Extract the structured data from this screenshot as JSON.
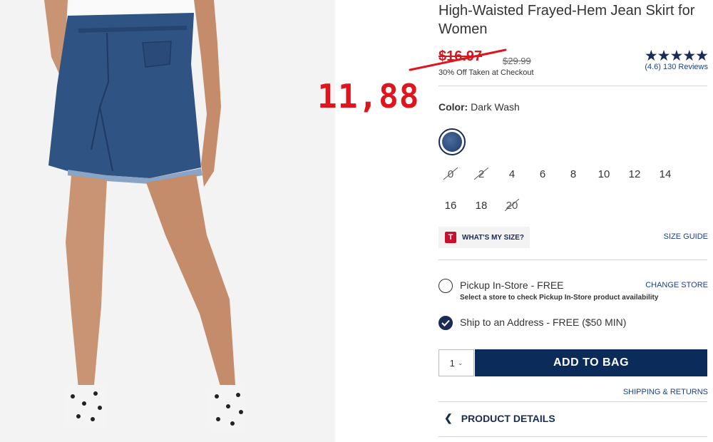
{
  "product": {
    "title": "High-Waisted Frayed-Hem Jean Skirt for Women",
    "sale_price": "$16.97",
    "original_price": "$29.99",
    "promo_note": "30% Off Taken at Checkout",
    "rating_stars": "★★★★★",
    "reviews": "(4.6) 130 Reviews",
    "image_alt": "denim skirt product photo"
  },
  "annotation": {
    "handwritten_price": "11,88",
    "color": "#e0141c"
  },
  "color": {
    "label": "Color:",
    "value": "Dark Wash",
    "swatch_color": "#2b4a78"
  },
  "sizes": [
    {
      "label": "0",
      "available": false
    },
    {
      "label": "2",
      "available": false
    },
    {
      "label": "4",
      "available": true
    },
    {
      "label": "6",
      "available": true
    },
    {
      "label": "8",
      "available": true
    },
    {
      "label": "10",
      "available": true
    },
    {
      "label": "12",
      "available": true
    },
    {
      "label": "14",
      "available": true
    },
    {
      "label": "16",
      "available": true
    },
    {
      "label": "18",
      "available": true
    },
    {
      "label": "20",
      "available": false
    }
  ],
  "fit": {
    "badge_letter": "T",
    "label": "WHAT'S MY SIZE?",
    "size_guide": "SIZE GUIDE"
  },
  "fulfillment": {
    "pickup_label": "Pickup In-Store - FREE",
    "pickup_sub": "Select a store to check Pickup In-Store product availability",
    "change_store": "CHANGE STORE",
    "ship_label": "Ship to an Address - FREE ($50 MIN)",
    "selected": "ship"
  },
  "cart": {
    "quantity": "1",
    "add_to_bag": "ADD TO BAG",
    "shipping_returns": "SHIPPING & RETURNS"
  },
  "details": {
    "label": "PRODUCT DETAILS"
  },
  "colors": {
    "navy": "#0b2c5b",
    "link": "#1a3f8a",
    "sale_red": "#cc1d25"
  }
}
